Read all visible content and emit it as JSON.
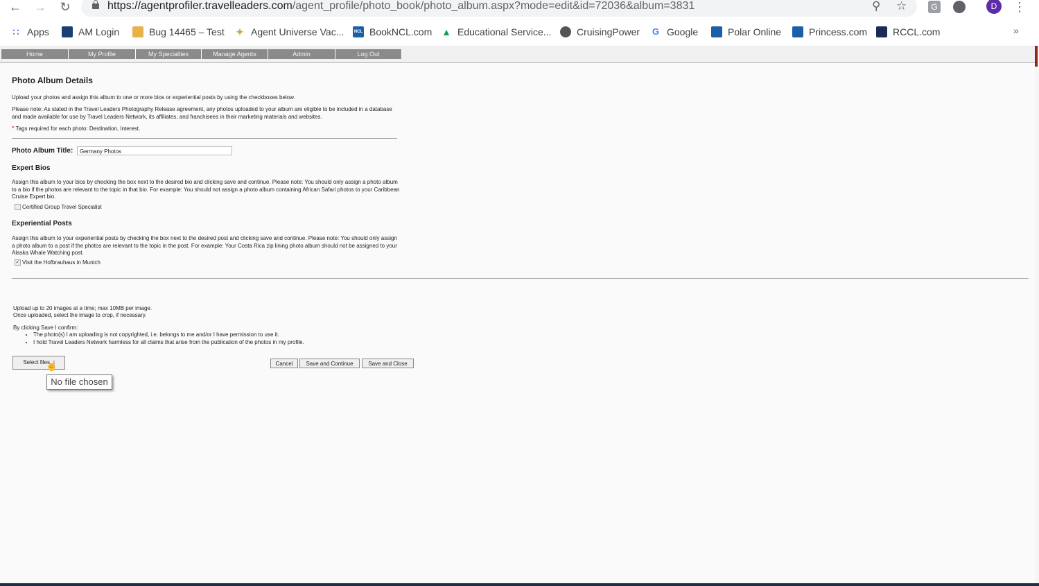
{
  "browser": {
    "url_host": "https://agentprofiler.travelleaders.com",
    "url_path": "/agent_profile/photo_book/photo_album.aspx?mode=edit&id=72036&album=3831",
    "profile_initial": "D",
    "bookmarks": [
      {
        "label": "Apps",
        "icon": "apps-grid-icon",
        "color": "#4285f4"
      },
      {
        "label": "AM Login",
        "icon": "am-login-icon",
        "color": "#1c3f73"
      },
      {
        "label": "Bug 14465 – Test",
        "icon": "bug-icon",
        "color": "#e8b24a"
      },
      {
        "label": "Agent Universe Vac...",
        "icon": "star-icon",
        "color": "#c9a84c"
      },
      {
        "label": "BookNCL.com",
        "icon": "ncl-icon",
        "color": "#1b5fa8"
      },
      {
        "label": "Educational Service...",
        "icon": "drive-icon",
        "color": "#0f9d58"
      },
      {
        "label": "CruisingPower",
        "icon": "globe-icon",
        "color": "#555555"
      },
      {
        "label": "Google",
        "icon": "google-icon",
        "color": "#4285f4"
      },
      {
        "label": "Polar Online",
        "icon": "polar-icon",
        "color": "#1b5fa8"
      },
      {
        "label": "Princess.com",
        "icon": "princess-icon",
        "color": "#1b5fa8"
      },
      {
        "label": "RCCL.com",
        "icon": "rccl-icon",
        "color": "#1c2a5a"
      }
    ],
    "more_label": "»"
  },
  "sitenav": {
    "items": [
      "Home",
      "My Profile",
      "My Specialties",
      "Manage Agents",
      "Admin",
      "Log Out"
    ]
  },
  "page": {
    "title": "Photo Album Details",
    "intro": "Upload your photos and assign this album to one or more bios or experiential posts by using the checkboxes below.",
    "note": "Please note: As stated in the Travel Leaders Photography Release agreement, any photos uploaded to your album are eligible to be included in a database and made available for use by Travel Leaders Network, its affiliates, and franchisees in their marketing materials and websites.",
    "required_mark": "*",
    "tags_note": "Tags required for each photo: Destination, Interest.",
    "album_title_label": "Photo Album Title:",
    "album_title_value": "Germany Photos",
    "expert_bios_heading": "Expert Bios",
    "expert_bios_text": "Assign this album to your bios by checking the box next to the desired bio and clicking save and continue. Please note: You should only assign a photo album to a bio if the photos are relevant to the topic in that bio. For example: You should not assign a photo album containing African Safari photos to your Caribbean Cruise Expert bio.",
    "bio_option": "Certified Group Travel Specialist",
    "bio_checked": false,
    "experiential_heading": "Experiential Posts",
    "experiential_text": "Assign this album to your experiential posts by checking the box next to the desired post and clicking save and continue. Please note: You should only assign a photo album to a post if the photos are relevant to the topic in the post. For example: Your Costa Rica zip lining photo album should not be assigned to your Alaska Whale Watching post.",
    "post_option": "Visit the Hofbrauhaus in Munich",
    "post_checked": true,
    "upload_line1": "Upload up to 20 images at a time; max 10MB per image.",
    "upload_line2": "Once uploaded, select the image to crop, if necessary.",
    "confirm_heading": "By clicking Save I confirm:",
    "confirm_items": [
      "The photo(s) I am uploading is not copyrighted, i.e. belongs to me and/or I have permission to use it.",
      "I hold Travel Leaders Network harmless for all claims that arise from the publication of the photos in my profile."
    ],
    "select_files_label": "Select files...",
    "no_file_tooltip": "No file chosen",
    "cancel_label": "Cancel",
    "save_continue_label": "Save and Continue",
    "save_close_label": "Save and Close"
  }
}
